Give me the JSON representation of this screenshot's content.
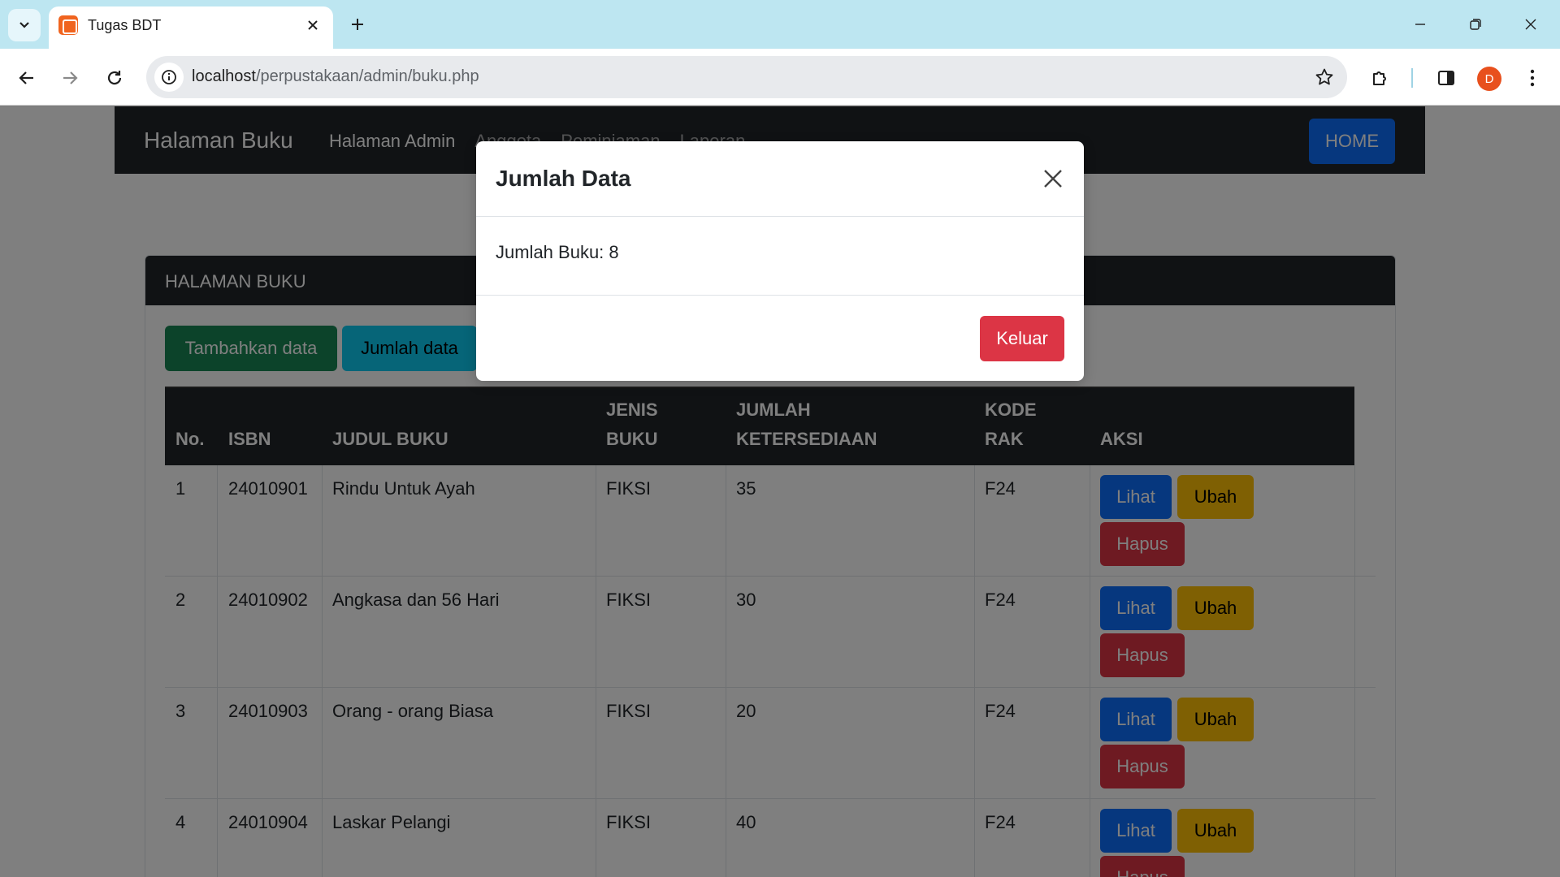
{
  "browser": {
    "tab_title": "Tugas BDT",
    "url_host": "localhost",
    "url_path": "/perpustakaan/admin/buku.php",
    "profile_initial": "D"
  },
  "navbar": {
    "brand": "Halaman Buku",
    "links": [
      "Halaman Admin",
      "Anggota",
      "Peminjaman",
      "Laporan"
    ],
    "home_button": "HOME"
  },
  "card": {
    "header": "HALAMAN BUKU",
    "add_button": "Tambahkan data",
    "count_button": "Jumlah data"
  },
  "table": {
    "headers": {
      "no": "No.",
      "isbn": "ISBN",
      "judul": "JUDUL BUKU",
      "jenis_1": "JENIS",
      "jenis_2": "BUKU",
      "jumlah_1": "JUMLAH",
      "jumlah_2": "KETERSEDIAAN",
      "kode_1": "KODE",
      "kode_2": "RAK",
      "aksi": "AKSI"
    },
    "rows": [
      {
        "no": "1",
        "isbn": "24010901",
        "judul": "Rindu Untuk Ayah",
        "jenis": "FIKSI",
        "jumlah": "35",
        "kode": "F24"
      },
      {
        "no": "2",
        "isbn": "24010902",
        "judul": "Angkasa dan 56 Hari",
        "jenis": "FIKSI",
        "jumlah": "30",
        "kode": "F24"
      },
      {
        "no": "3",
        "isbn": "24010903",
        "judul": "Orang - orang Biasa",
        "jenis": "FIKSI",
        "jumlah": "20",
        "kode": "F24"
      },
      {
        "no": "4",
        "isbn": "24010904",
        "judul": "Laskar Pelangi",
        "jenis": "FIKSI",
        "jumlah": "40",
        "kode": "F24"
      }
    ],
    "actions": {
      "view": "Lihat",
      "edit": "Ubah",
      "delete": "Hapus"
    }
  },
  "modal": {
    "title": "Jumlah Data",
    "body": "Jumlah Buku: 8",
    "close_button": "Keluar"
  },
  "colors": {
    "primary": "#0d6efd",
    "success": "#198754",
    "info": "#0dcaf0",
    "warning": "#ffc107",
    "danger": "#dc3545",
    "dark": "#212529"
  }
}
